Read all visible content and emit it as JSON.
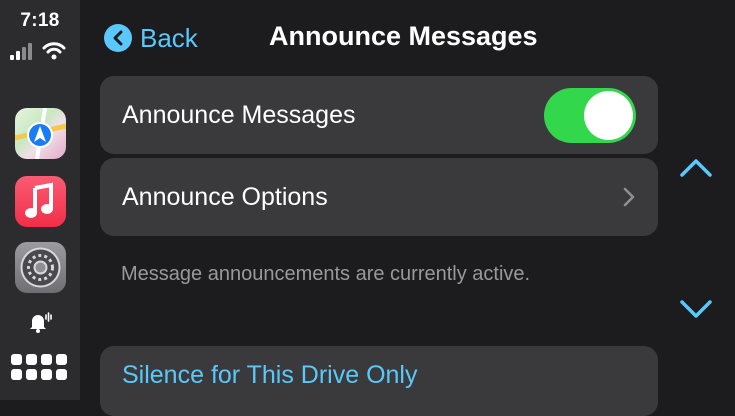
{
  "status": {
    "time": "7:18"
  },
  "sidebar": {
    "apps": [
      {
        "name": "Maps",
        "icon": "maps-icon"
      },
      {
        "name": "Music",
        "icon": "music-icon"
      },
      {
        "name": "Settings",
        "icon": "settings-icon"
      }
    ],
    "notification_icon": "bell-icon",
    "dashboard_icon": "app-grid-icon"
  },
  "header": {
    "back_label": "Back",
    "title": "Announce Messages"
  },
  "settings": {
    "announce_toggle": {
      "label": "Announce Messages",
      "on": true
    },
    "announce_options": {
      "label": "Announce Options"
    },
    "footnote": "Message announcements are currently active.",
    "silence_label": "Silence for This Drive Only"
  },
  "colors": {
    "accent": "#5ac8fa",
    "toggle_on": "#32d74b",
    "background": "#1c1c1e",
    "row_bg": "#3a3a3c",
    "sidebar_bg": "#2c2c2e"
  },
  "scroll": {
    "up_icon": "chevron-up-icon",
    "down_icon": "chevron-down-icon"
  }
}
